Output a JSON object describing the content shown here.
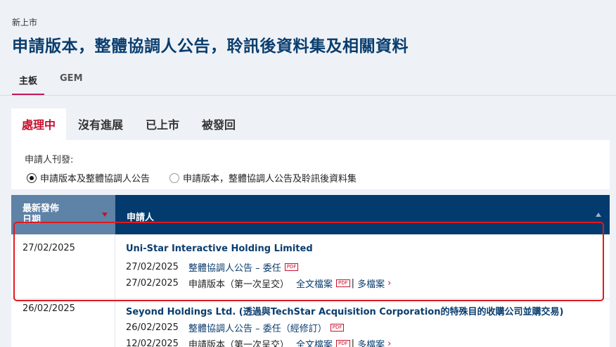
{
  "breadcrumb": "新上市",
  "page_title": "申請版本，整體協調人公告，聆訊後資料集及相關資料",
  "board_tabs": [
    {
      "label": "主板",
      "active": true
    },
    {
      "label": "GEM",
      "active": false
    }
  ],
  "status_tabs": [
    {
      "label": "處理中",
      "active": true
    },
    {
      "label": "沒有進展",
      "active": false
    },
    {
      "label": "已上市",
      "active": false
    },
    {
      "label": "被發回",
      "active": false
    }
  ],
  "filter": {
    "label": "申請人刊發:",
    "options": [
      {
        "label": "申請版本及整體協調人公告",
        "selected": true
      },
      {
        "label": "申請版本，整體協調人公告及聆訊後資料集",
        "selected": false
      }
    ]
  },
  "table": {
    "headers": {
      "date": "最新發佈日期",
      "applicant": "申請人"
    },
    "rows": [
      {
        "date": "27/02/2025",
        "applicant": "Uni-Star Interactive Holding Limited",
        "docs": [
          {
            "date": "27/02/2025",
            "title": "整體協調人公告 – 委任",
            "pdf": "PDF"
          },
          {
            "date": "27/02/2025",
            "title": "申請版本（第一次呈交）",
            "full_text": "全文檔案",
            "pdf": "PDF",
            "more": "多檔案"
          }
        ]
      },
      {
        "date": "26/02/2025",
        "applicant": "Seyond Holdings Ltd. (透過與TechStar Acquisition Corporation的特殊目的收購公司並購交易)",
        "docs": [
          {
            "date": "26/02/2025",
            "title": "整體協調人公告 – 委任（經修訂）",
            "pdf": "PDF"
          },
          {
            "date": "12/02/2025",
            "title": "申請版本（第一次呈交）",
            "full_text": "全文檔案",
            "pdf": "PDF",
            "more": "多檔案"
          }
        ]
      }
    ]
  },
  "colors": {
    "brand_navy": "#033b6e",
    "accent_red": "#c8102e",
    "highlight_red": "#e0191f"
  }
}
